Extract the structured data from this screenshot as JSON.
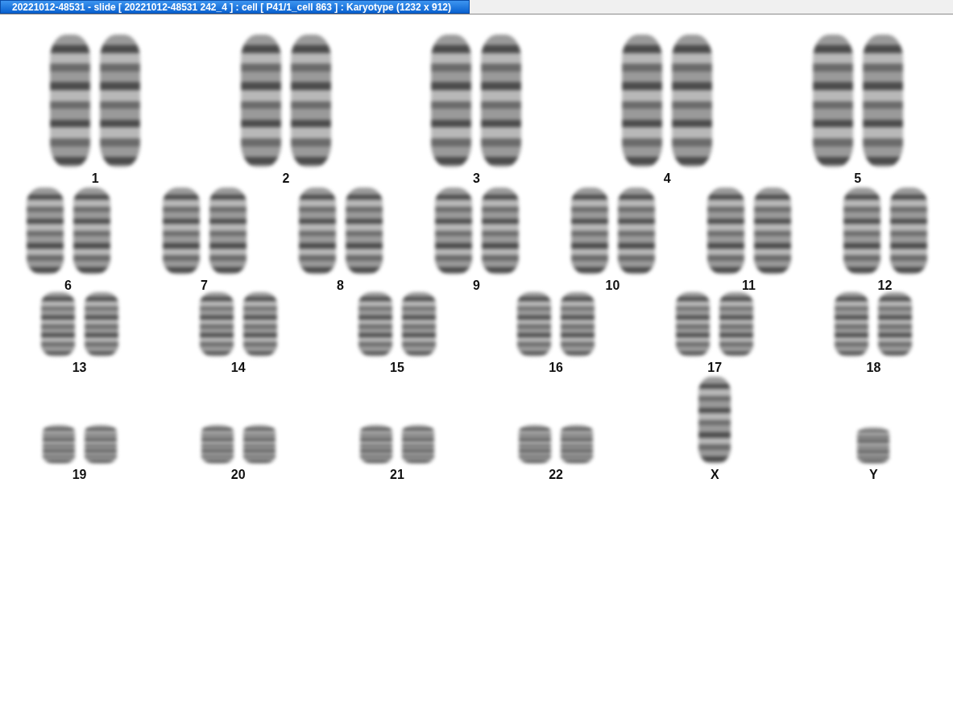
{
  "window": {
    "title": "20221012-48531 - slide [ 20221012-48531 242_4 ] : cell [ P41/1_cell 863 ] : Karyotype  (1232 x 912)"
  },
  "karyotype": {
    "rows": [
      [
        {
          "label": "1",
          "kind": "pair"
        },
        {
          "label": "2",
          "kind": "pair"
        },
        {
          "label": "3",
          "kind": "pair"
        },
        {
          "label": "4",
          "kind": "pair"
        },
        {
          "label": "5",
          "kind": "pair"
        }
      ],
      [
        {
          "label": "6",
          "kind": "pair"
        },
        {
          "label": "7",
          "kind": "pair"
        },
        {
          "label": "8",
          "kind": "pair"
        },
        {
          "label": "9",
          "kind": "pair"
        },
        {
          "label": "10",
          "kind": "pair"
        },
        {
          "label": "11",
          "kind": "pair"
        },
        {
          "label": "12",
          "kind": "pair"
        }
      ],
      [
        {
          "label": "13",
          "kind": "pair"
        },
        {
          "label": "14",
          "kind": "pair"
        },
        {
          "label": "15",
          "kind": "pair"
        },
        {
          "label": "16",
          "kind": "pair"
        },
        {
          "label": "17",
          "kind": "pair"
        },
        {
          "label": "18",
          "kind": "pair"
        }
      ],
      [
        {
          "label": "19",
          "kind": "pair"
        },
        {
          "label": "20",
          "kind": "pair"
        },
        {
          "label": "21",
          "kind": "pair"
        },
        {
          "label": "22",
          "kind": "pair"
        },
        {
          "label": "X",
          "kind": "single"
        },
        {
          "label": "Y",
          "kind": "single"
        }
      ]
    ]
  }
}
